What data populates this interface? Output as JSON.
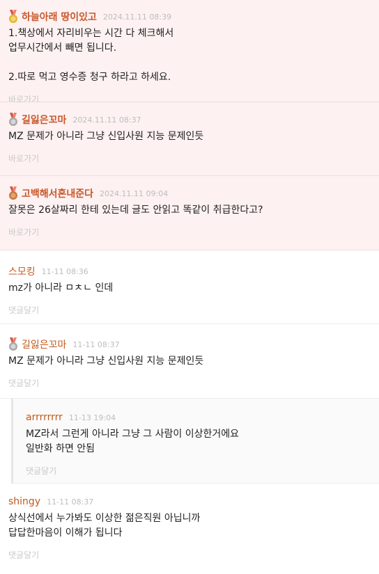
{
  "comments": [
    {
      "nickname": "하늘아래 땅이있고",
      "date": "2024.11.11 08:39",
      "body": "1.책상에서 자리비우는 시간 다 체크해서\n업무시간에서 빼면 됩니다.\n\n2.따로 먹고 영수증 청구 하라고 하세요.",
      "action": "바로가기",
      "medal": "gold-medal-icon"
    },
    {
      "nickname": "길잃은꼬마",
      "date": "2024.11.11 08:37",
      "body": "MZ 문제가 아니라 그냥 신입사원 지능 문제인듯",
      "action": "바로가기",
      "medal": "silver-medal-icon"
    },
    {
      "nickname": "고백해서혼내준다",
      "date": "2024.11.11 09:04",
      "body": "잘못은 26살짜리 한테 있는데 글도 안읽고 똑같이 취급한다고?",
      "action": "바로가기",
      "medal": "bronze-medal-icon"
    },
    {
      "nickname": "스모킹",
      "date": "11-11 08:36",
      "body": "mz가 아니라 ㅁㅊㄴ 인데",
      "action": "댓글달기"
    },
    {
      "nickname": "길잃은꼬마",
      "date": "11-11 08:37",
      "body": "MZ 문제가 아니라 그냥 신입사원 지능 문제인듯",
      "action": "댓글달기",
      "medal": "silver-medal-icon"
    },
    {
      "nickname": "arrrrrrrr",
      "date": "11-13 19:04",
      "body": "MZ라서 그런게 아니라 그냥 그 사람이 이상한거에요\n일반화 하면 안됨",
      "action": "댓글달기"
    },
    {
      "nickname": "shingy",
      "date": "11-11 08:37",
      "body": "상식선에서 누가봐도 이상한 젊은직원 아닙니까\n답답한마음이 이해가 됩니다",
      "action": "댓글달기"
    }
  ],
  "colors": {
    "nickname": "#c8572a",
    "best_background": "#fdf1f1",
    "date": "#bdbdbd",
    "action": "#c9c9c9",
    "gold": "#e7b52c",
    "silver": "#a9a9a9",
    "bronze": "#c97a3c",
    "ribbon": "#d9534f"
  }
}
